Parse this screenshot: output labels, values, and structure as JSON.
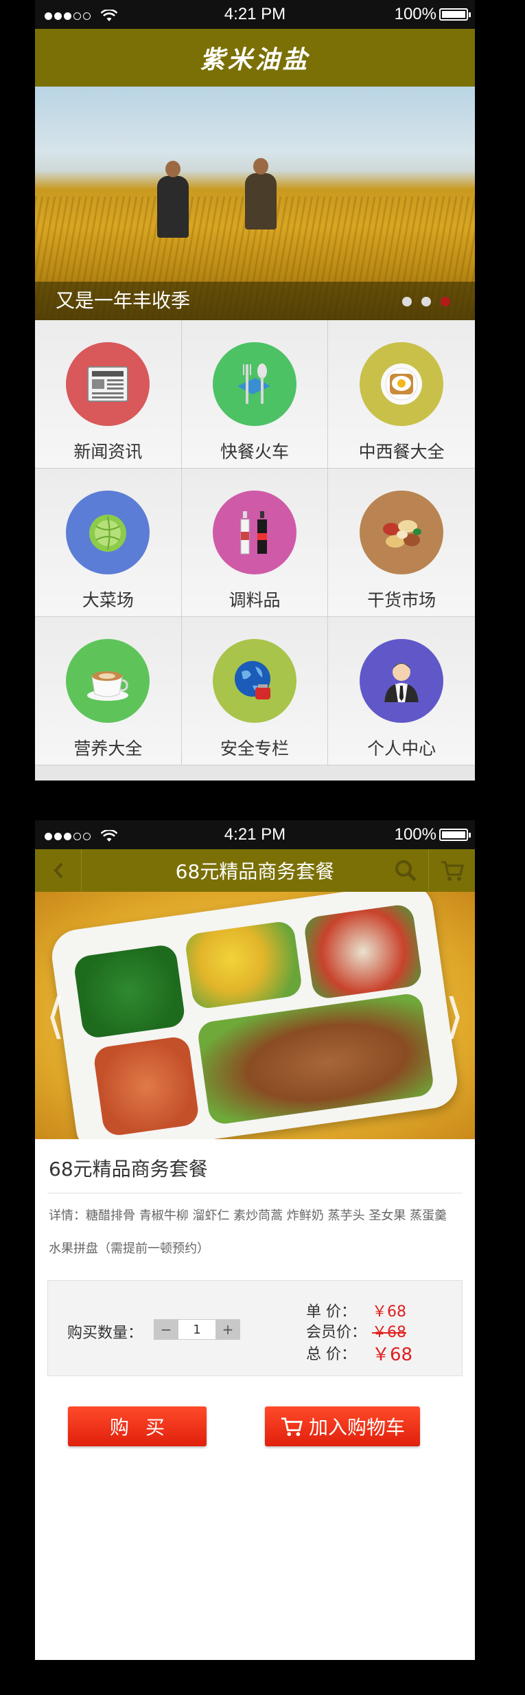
{
  "screen1": {
    "status": {
      "time": "4:21 PM",
      "battery": "100%"
    },
    "header": {
      "title": "紫米油盐"
    },
    "banner": {
      "caption": "又是一年丰收季",
      "dots": 3,
      "active_dot": 3
    },
    "grid": [
      {
        "label": "新闻资讯",
        "icon": "newspaper-icon",
        "color": "#d9585a"
      },
      {
        "label": "快餐火车",
        "icon": "fork-spoon-icon",
        "color": "#4cc265"
      },
      {
        "label": "中西餐大全",
        "icon": "fried-egg-icon",
        "color": "#c9c04a"
      },
      {
        "label": "大菜场",
        "icon": "cabbage-icon",
        "color": "#5b7dd6"
      },
      {
        "label": "调料品",
        "icon": "bottles-icon",
        "color": "#cf5aa8"
      },
      {
        "label": "干货市场",
        "icon": "nuts-icon",
        "color": "#b98452"
      },
      {
        "label": "营养大全",
        "icon": "coffee-cup-icon",
        "color": "#5ec45a"
      },
      {
        "label": "安全专栏",
        "icon": "globe-icon",
        "color": "#a8c44a"
      },
      {
        "label": "个人中心",
        "icon": "user-icon",
        "color": "#6058c8"
      }
    ]
  },
  "screen2": {
    "status": {
      "time": "4:21 PM",
      "battery": "100%"
    },
    "nav": {
      "title": "68元精品商务套餐"
    },
    "product": {
      "name": "68元精品商务套餐",
      "details_label": "详情：",
      "details_line1": "糖醋排骨  青椒牛柳  溜虾仁  素炒茼蒿  炸鲜奶  蒸芋头  圣女果  蒸蛋羹",
      "details_line2": "水果拼盘（需提前一顿预约）"
    },
    "purchase": {
      "qty_label": "购买数量：",
      "qty_minus": "−",
      "qty_value": "1",
      "qty_plus": "+",
      "unit_price_label": "单    价：",
      "unit_price": "￥68",
      "member_price_label": "会员价：",
      "member_price": "￥68",
      "total_label": "总    价：",
      "total": "￥68"
    },
    "actions": {
      "buy": "购买",
      "add_to_cart": "加入购物车"
    }
  }
}
